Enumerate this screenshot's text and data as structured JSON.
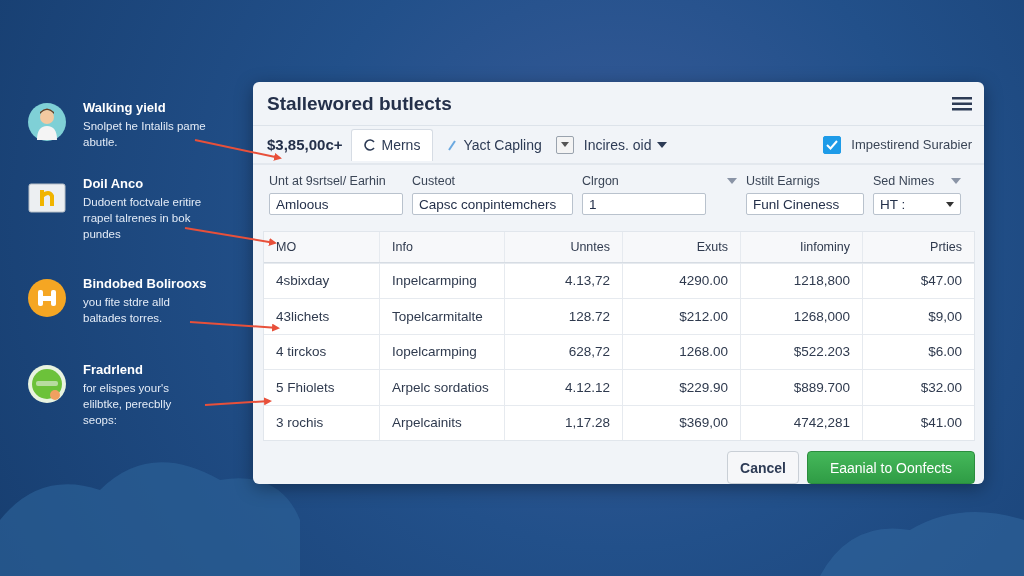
{
  "callouts": [
    {
      "kind": "person",
      "title": "Walking yield",
      "text": "Snolpet he Intalils pame abutle."
    },
    {
      "kind": "document",
      "title": "Doil Anco",
      "text": "Dudoent foctvale eritire rrapel talrenes in bok pundes"
    },
    {
      "kind": "badge",
      "title": "Bindobed Bolirooxs",
      "text": "you fite stdre alld baltades torres."
    },
    {
      "kind": "globe",
      "title": "Fradrlend",
      "text": "for elispes your's elilbtke, perecblly seops:"
    }
  ],
  "dialog": {
    "title": "Stallewored butlects",
    "toolbar": {
      "amount": "$3,85,00c+",
      "tabs": [
        {
          "label": "Merns",
          "selected": true
        },
        {
          "label": "Yact Capling",
          "selected": false
        }
      ],
      "menu": "Incires. oid",
      "checkbox": {
        "label": "Impestirend Surabier",
        "checked": true
      }
    },
    "filters": [
      {
        "label": "Unt at 9srtsel/ Earhin",
        "value": "Amloous",
        "kind": "input",
        "has_menu": false
      },
      {
        "label": "Custeot",
        "value": "Capsc conpintemchers",
        "kind": "input",
        "has_menu": false
      },
      {
        "label": "Clrgon",
        "value": "1",
        "kind": "input",
        "has_menu": true
      },
      {
        "label": "Ustilt Earnigs",
        "value": "Funl Cineness",
        "kind": "input",
        "has_menu": false
      },
      {
        "label": "Sed Nimes",
        "value": "HT :",
        "kind": "select",
        "has_menu": true
      }
    ],
    "table": {
      "columns": [
        "MO",
        "Info",
        "Unntes",
        "Exuts",
        "Iinfominy",
        "Prties"
      ],
      "rows": [
        [
          "4sbixday",
          "Inpelcarmping",
          "4.13,72",
          "4290.00",
          "1218,800",
          "$47.00"
        ],
        [
          "43lichets",
          "Topelcarmitalte",
          "128.72",
          "$212.00",
          "1268,000",
          "$9,00"
        ],
        [
          "4 tirckos",
          "Iopelcarmping",
          "628,72",
          "1268.00",
          "$522.203",
          "$6.00"
        ],
        [
          "5 Fhiolets",
          "Arpelc sordatios",
          "4.12.12",
          "$229.90",
          "$889.700",
          "$32.00"
        ],
        [
          "3 rochis",
          "Arpelcainits",
          "1,17.28",
          "$369,00",
          "4742,281",
          "$41.00"
        ]
      ]
    },
    "buttons": [
      {
        "label": "Cancel",
        "kind": "secondary"
      },
      {
        "label": "Eaanial to Oonfects",
        "kind": "primary"
      }
    ]
  }
}
